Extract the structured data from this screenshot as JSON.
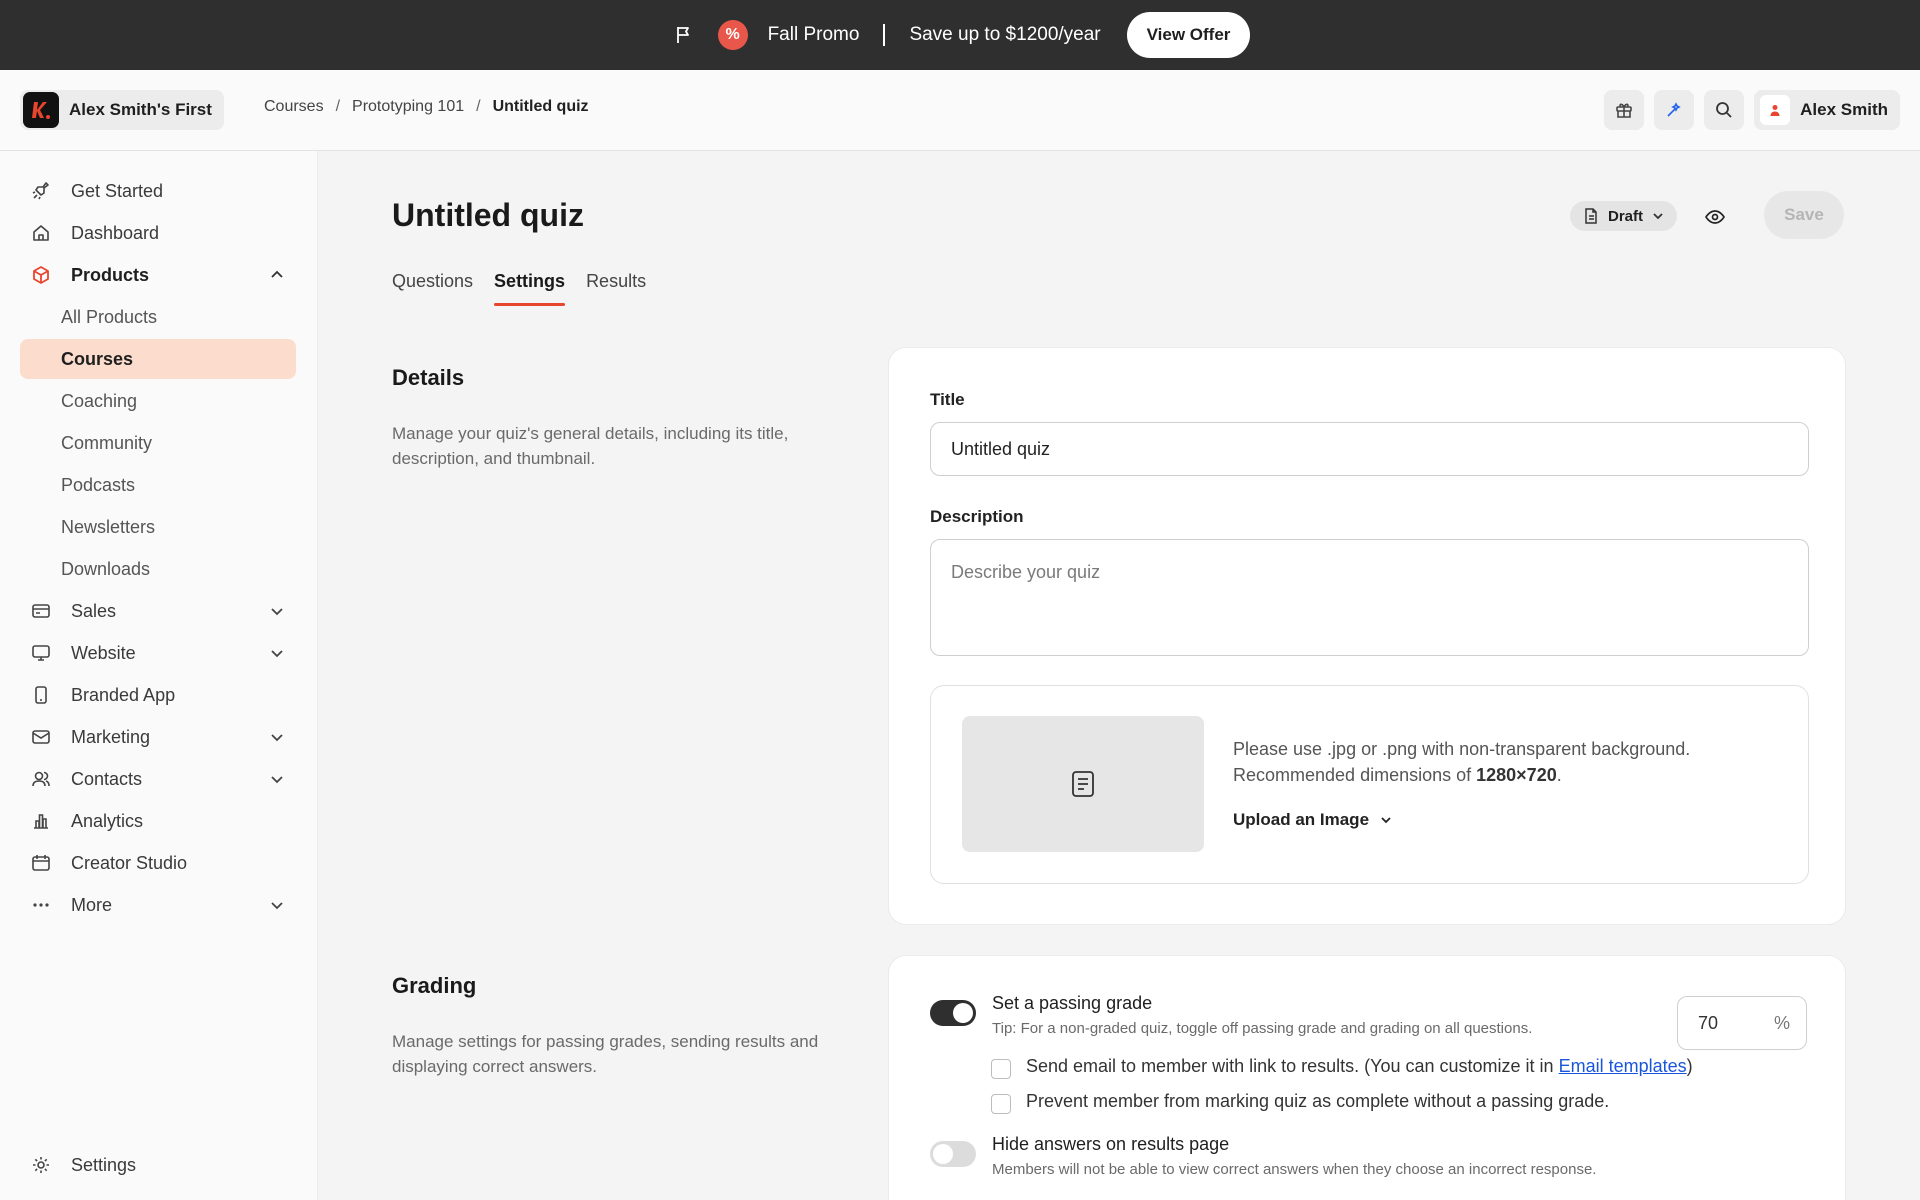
{
  "promo": {
    "title": "Fall Promo",
    "message": "Save up to $1200/year",
    "cta": "View Offer",
    "badge_glyph": "%"
  },
  "header": {
    "workspace_name": "Alex Smith's First",
    "logo_letter": "k.",
    "breadcrumbs": [
      "Courses",
      "Prototyping 101",
      "Untitled quiz"
    ],
    "user_name": "Alex Smith"
  },
  "sidebar": {
    "items": [
      {
        "label": "Get Started",
        "icon": "rocket-icon"
      },
      {
        "label": "Dashboard",
        "icon": "home-icon"
      },
      {
        "label": "Products",
        "icon": "box-icon",
        "expanded": true
      },
      {
        "label": "All Products"
      },
      {
        "label": "Courses",
        "active": true
      },
      {
        "label": "Coaching"
      },
      {
        "label": "Community"
      },
      {
        "label": "Podcasts"
      },
      {
        "label": "Newsletters"
      },
      {
        "label": "Downloads"
      },
      {
        "label": "Sales",
        "icon": "credit-card-icon"
      },
      {
        "label": "Website",
        "icon": "monitor-icon"
      },
      {
        "label": "Branded App",
        "icon": "phone-icon"
      },
      {
        "label": "Marketing",
        "icon": "mail-icon"
      },
      {
        "label": "Contacts",
        "icon": "users-icon"
      },
      {
        "label": "Analytics",
        "icon": "bar-chart-icon"
      },
      {
        "label": "Creator Studio",
        "icon": "calendar-icon"
      },
      {
        "label": "More",
        "icon": "dots-icon"
      },
      {
        "label": "Settings",
        "icon": "gear-icon"
      }
    ]
  },
  "page": {
    "title": "Untitled quiz",
    "status": "Draft",
    "save_label": "Save",
    "tabs": [
      {
        "label": "Questions"
      },
      {
        "label": "Settings",
        "active": true
      },
      {
        "label": "Results"
      }
    ]
  },
  "details": {
    "heading": "Details",
    "description": "Manage your quiz's general details, including its title, description, and thumbnail.",
    "title_label": "Title",
    "title_value": "Untitled quiz",
    "description_label": "Description",
    "description_placeholder": "Describe your quiz",
    "upload_hint_line1": "Please use .jpg or .png with non-transparent background.",
    "upload_hint_line2_prefix": "Recommended dimensions of ",
    "upload_hint_dims": "1280×720",
    "upload_hint_suffix": ".",
    "upload_label": "Upload an Image"
  },
  "grading": {
    "heading": "Grading",
    "description": "Manage settings for passing grades, sending results and displaying correct answers.",
    "passing_grade_label": "Set a passing grade",
    "passing_grade_enabled": true,
    "passing_grade_tip": "Tip: For a non-graded quiz, toggle off passing grade and grading on all questions.",
    "passing_grade_value": "70",
    "passing_grade_unit": "%",
    "email_results_prefix": "Send email to member with link to results. (You can customize it in ",
    "email_results_link": "Email templates",
    "email_results_suffix": ")",
    "email_results_checked": false,
    "prevent_complete_label": "Prevent member from marking quiz as complete without a passing grade.",
    "prevent_complete_checked": false,
    "hide_answers_label": "Hide answers on results page",
    "hide_answers_enabled": false,
    "hide_answers_tip": "Members will not be able to view correct answers when they choose an incorrect response."
  },
  "colors": {
    "accent": "#e8452f",
    "active_nav_bg": "#fcdccd",
    "promo_bg": "#2f2f2f",
    "link": "#1a56db"
  }
}
